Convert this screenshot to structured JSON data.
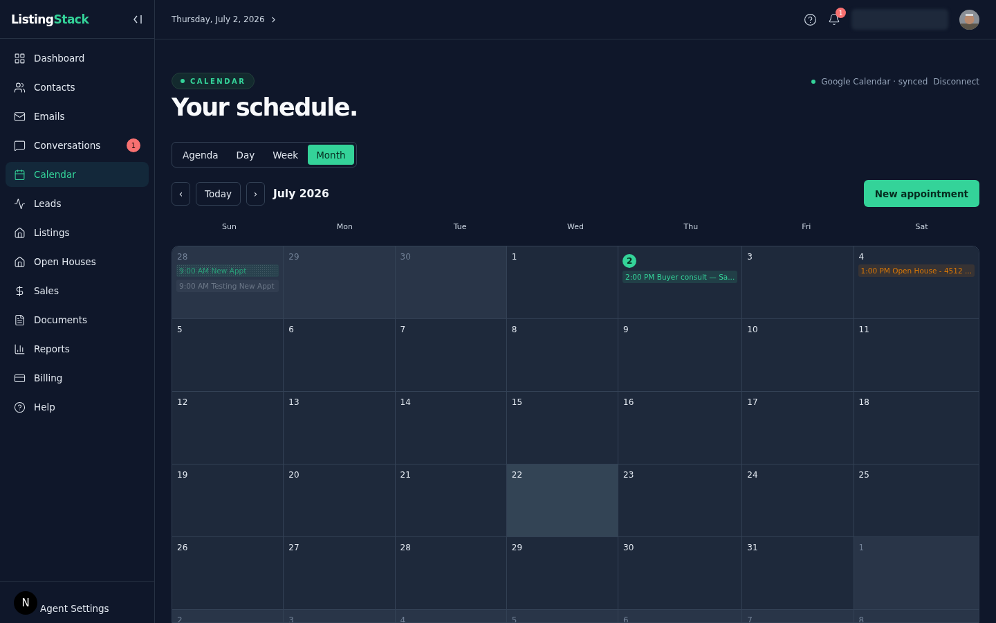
{
  "brand": {
    "first": "Listing",
    "second": "Stack"
  },
  "sidebar": {
    "items": [
      {
        "label": "Dashboard",
        "selected": false
      },
      {
        "label": "Contacts",
        "selected": false
      },
      {
        "label": "Emails",
        "selected": false
      },
      {
        "label": "Conversations",
        "selected": false,
        "badge": "1"
      },
      {
        "label": "Calendar",
        "selected": true
      },
      {
        "label": "Leads",
        "selected": false
      },
      {
        "label": "Listings",
        "selected": false
      },
      {
        "label": "Open Houses",
        "selected": false
      },
      {
        "label": "Sales",
        "selected": false
      },
      {
        "label": "Documents",
        "selected": false
      },
      {
        "label": "Reports",
        "selected": false
      },
      {
        "label": "Billing",
        "selected": false
      },
      {
        "label": "Help",
        "selected": false
      }
    ],
    "footer": {
      "avatar": "N",
      "label": "Agent Settings"
    }
  },
  "topbar": {
    "date": "Thursday, July 2, 2026",
    "notifications": "1"
  },
  "header": {
    "eyebrow": "CALENDAR",
    "title": "Your schedule.",
    "sync_status": "Google Calendar · synced",
    "disconnect": "Disconnect"
  },
  "views": [
    {
      "label": "Agenda",
      "selected": false
    },
    {
      "label": "Day",
      "selected": false
    },
    {
      "label": "Week",
      "selected": false
    },
    {
      "label": "Month",
      "selected": true
    }
  ],
  "nav": {
    "prev": "‹",
    "today": "Today",
    "next": "›",
    "month": "July 2026",
    "new_button": "New appointment"
  },
  "weekdays": [
    "Sun",
    "Mon",
    "Tue",
    "Wed",
    "Thu",
    "Fri",
    "Sat"
  ],
  "weeks": [
    [
      {
        "day": "28",
        "outside": true,
        "today": false,
        "highlighted": false,
        "events": [
          {
            "text": "9:00 AM New Appt",
            "color": "#2a9d78",
            "dotted": true
          },
          {
            "text": "9:00 AM Testing New Appt",
            "color": "#6b7787",
            "dotted": false
          }
        ]
      },
      {
        "day": "29",
        "outside": true,
        "today": false,
        "highlighted": false
      },
      {
        "day": "30",
        "outside": true,
        "today": false,
        "highlighted": false
      },
      {
        "day": "1",
        "outside": false,
        "today": false,
        "highlighted": false
      },
      {
        "day": "2",
        "outside": false,
        "today": true,
        "highlighted": false,
        "events": [
          {
            "text": "2:00 PM Buyer consult — Sa...",
            "color": "#34d399",
            "dotted": false
          }
        ]
      },
      {
        "day": "3",
        "outside": false,
        "today": false,
        "highlighted": false
      },
      {
        "day": "4",
        "outside": false,
        "today": false,
        "highlighted": false,
        "events": [
          {
            "text": "1:00 PM Open House - 4512 ...",
            "color": "#d97706",
            "dotted": false
          }
        ]
      }
    ],
    [
      {
        "day": "5",
        "outside": false,
        "today": false,
        "highlighted": false
      },
      {
        "day": "6",
        "outside": false,
        "today": false,
        "highlighted": false
      },
      {
        "day": "7",
        "outside": false,
        "today": false,
        "highlighted": false
      },
      {
        "day": "8",
        "outside": false,
        "today": false,
        "highlighted": false
      },
      {
        "day": "9",
        "outside": false,
        "today": false,
        "highlighted": false
      },
      {
        "day": "10",
        "outside": false,
        "today": false,
        "highlighted": false
      },
      {
        "day": "11",
        "outside": false,
        "today": false,
        "highlighted": false
      }
    ],
    [
      {
        "day": "12",
        "outside": false,
        "today": false,
        "highlighted": false
      },
      {
        "day": "13",
        "outside": false,
        "today": false,
        "highlighted": false
      },
      {
        "day": "14",
        "outside": false,
        "today": false,
        "highlighted": false
      },
      {
        "day": "15",
        "outside": false,
        "today": false,
        "highlighted": false
      },
      {
        "day": "16",
        "outside": false,
        "today": false,
        "highlighted": false
      },
      {
        "day": "17",
        "outside": false,
        "today": false,
        "highlighted": false
      },
      {
        "day": "18",
        "outside": false,
        "today": false,
        "highlighted": false
      }
    ],
    [
      {
        "day": "19",
        "outside": false,
        "today": false,
        "highlighted": false
      },
      {
        "day": "20",
        "outside": false,
        "today": false,
        "highlighted": false
      },
      {
        "day": "21",
        "outside": false,
        "today": false,
        "highlighted": false
      },
      {
        "day": "22",
        "outside": false,
        "today": false,
        "highlighted": true
      },
      {
        "day": "23",
        "outside": false,
        "today": false,
        "highlighted": false
      },
      {
        "day": "24",
        "outside": false,
        "today": false,
        "highlighted": false
      },
      {
        "day": "25",
        "outside": false,
        "today": false,
        "highlighted": false
      }
    ],
    [
      {
        "day": "26",
        "outside": false,
        "today": false,
        "highlighted": false
      },
      {
        "day": "27",
        "outside": false,
        "today": false,
        "highlighted": false
      },
      {
        "day": "28",
        "outside": false,
        "today": false,
        "highlighted": false
      },
      {
        "day": "29",
        "outside": false,
        "today": false,
        "highlighted": false
      },
      {
        "day": "30",
        "outside": false,
        "today": false,
        "highlighted": false
      },
      {
        "day": "31",
        "outside": false,
        "today": false,
        "highlighted": false
      },
      {
        "day": "1",
        "outside": true,
        "today": false,
        "highlighted": false
      }
    ],
    [
      {
        "day": "2",
        "outside": true,
        "today": false,
        "highlighted": false
      },
      {
        "day": "3",
        "outside": true,
        "today": false,
        "highlighted": false
      },
      {
        "day": "4",
        "outside": true,
        "today": false,
        "highlighted": false
      },
      {
        "day": "5",
        "outside": true,
        "today": false,
        "highlighted": false
      },
      {
        "day": "6",
        "outside": true,
        "today": false,
        "highlighted": false
      },
      {
        "day": "7",
        "outside": true,
        "today": false,
        "highlighted": false
      },
      {
        "day": "8",
        "outside": true,
        "today": false,
        "highlighted": false
      }
    ]
  ]
}
